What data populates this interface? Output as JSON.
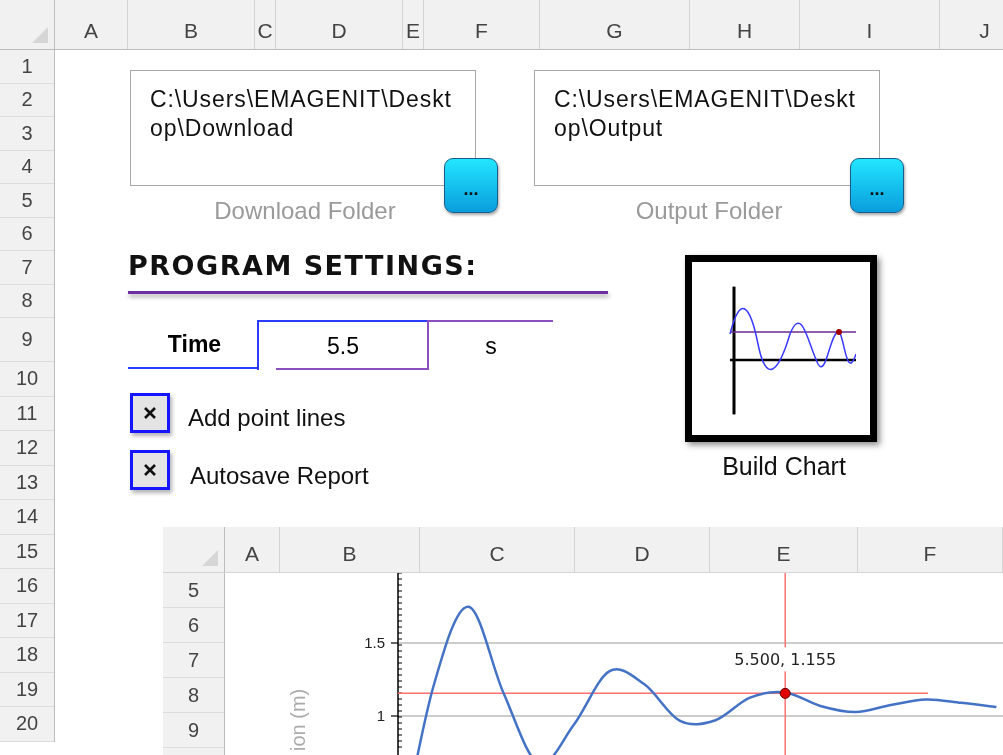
{
  "sheet": {
    "columns": [
      "A",
      "B",
      "C",
      "D",
      "E",
      "F",
      "G",
      "H",
      "I",
      "J"
    ],
    "rows": [
      "1",
      "2",
      "3",
      "4",
      "5",
      "6",
      "7",
      "8",
      "9",
      "10",
      "11",
      "12",
      "13",
      "14",
      "15",
      "16",
      "17",
      "18",
      "19",
      "20"
    ]
  },
  "folders": [
    {
      "path": "C:\\Users\\EMAGENIT\\Desktop\\Download",
      "button": "...",
      "caption": "Download Folder"
    },
    {
      "path": "C:\\Users\\EMAGENIT\\Desktop\\Output",
      "button": "...",
      "caption": "Output Folder"
    }
  ],
  "settings": {
    "title": "PROGRAM SETTINGS:",
    "time": {
      "label": "Time",
      "value": "5.5",
      "unit": "s"
    },
    "checkboxes": [
      {
        "label": "Add point lines",
        "checked": true
      },
      {
        "label": "Autosave Report",
        "checked": true
      }
    ]
  },
  "build_chart": {
    "label": "Build Chart"
  },
  "embedded_sheet": {
    "columns": [
      "A",
      "B",
      "C",
      "D",
      "E",
      "F"
    ],
    "rows": [
      "5",
      "6",
      "7",
      "8",
      "9"
    ],
    "chart": {
      "axis_title": "ion (m)",
      "y_tick_labels": [
        "1.5",
        "1"
      ],
      "point_label": "5.500, 1.155"
    }
  }
}
